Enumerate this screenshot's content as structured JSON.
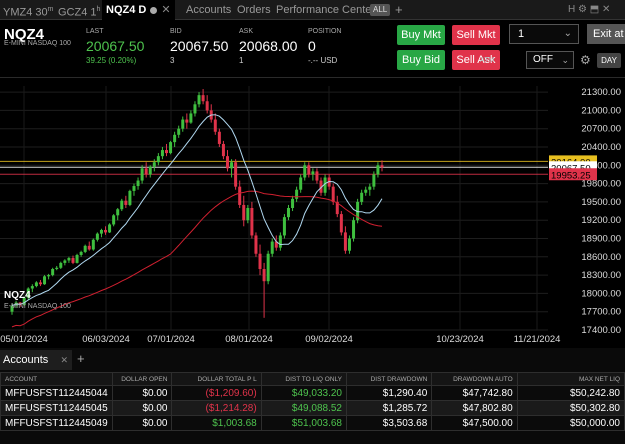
{
  "tabs": [
    {
      "label": "YMZ4 30",
      "suffix": "m"
    },
    {
      "label": "GCZ4 1",
      "suffix": "h"
    },
    {
      "label": "NQZ4 D"
    },
    {
      "label": "Accounts"
    },
    {
      "label": "Orders"
    },
    {
      "label": "Performance Center"
    }
  ],
  "tabs_badge": "ALL",
  "tabs_add": "+",
  "window_controls": "H ⚙ ⬒ ✕",
  "quote": {
    "symbol": "NQZ4",
    "description": "E-MINI NASDAQ 100",
    "last_label": "LAST",
    "last": "20067.50",
    "change": "39.25 (0.20%)",
    "bid_label": "BID",
    "bid": "20067.50",
    "bid_size": "3",
    "ask_label": "ASK",
    "ask": "20068.00",
    "ask_size": "1",
    "position_label": "POSITION",
    "position": "0",
    "position_value": "-.-- USD"
  },
  "order_buttons": {
    "buy_mkt": "Buy Mkt",
    "sell_mkt": "Sell Mkt",
    "buy_bid": "Buy Bid",
    "sell_ask": "Sell Ask",
    "quantity": "1",
    "exit": "Exit at",
    "atm_label": "ATM",
    "atm_value": "OFF",
    "day": "DAY"
  },
  "chart_data": {
    "type": "candlestick",
    "symbol": "NQZ4",
    "description": "E-MINI NASDAQ 100",
    "y_ticks": [
      "21300.00",
      "21000.00",
      "20700.00",
      "20400.00",
      "20100.00",
      "19800.00",
      "19500.00",
      "19200.00",
      "18900.00",
      "18600.00",
      "18300.00",
      "18000.00",
      "17700.00",
      "17400.00"
    ],
    "ylim": [
      17400,
      21400
    ],
    "x_ticks": [
      "05/01/2024",
      "06/03/2024",
      "07/01/2024",
      "08/01/2024",
      "09/02/2024",
      "10/23/2024",
      "11/21/2024"
    ],
    "price_labels": [
      {
        "text": "20164.00",
        "value": 20164,
        "color": "#e8c020"
      },
      {
        "text": "20067.50",
        "value": 20067.5,
        "color": "#ffffff"
      },
      {
        "text": "19953.25",
        "value": 19953.25,
        "color": "#e0334a"
      }
    ],
    "candles": [
      [
        17700,
        17830,
        17650,
        17800
      ],
      [
        17800,
        17880,
        17760,
        17850
      ],
      [
        17850,
        17860,
        17780,
        17810
      ],
      [
        17810,
        17950,
        17800,
        17930
      ],
      [
        17930,
        18100,
        17900,
        18080
      ],
      [
        18080,
        18150,
        18020,
        18120
      ],
      [
        18120,
        18200,
        18100,
        18180
      ],
      [
        18180,
        18220,
        18120,
        18150
      ],
      [
        18150,
        18300,
        18140,
        18280
      ],
      [
        18280,
        18320,
        18230,
        18300
      ],
      [
        18300,
        18420,
        18280,
        18400
      ],
      [
        18400,
        18450,
        18380,
        18420
      ],
      [
        18420,
        18520,
        18400,
        18500
      ],
      [
        18500,
        18560,
        18460,
        18540
      ],
      [
        18540,
        18600,
        18500,
        18580
      ],
      [
        18580,
        18620,
        18480,
        18500
      ],
      [
        18500,
        18650,
        18490,
        18630
      ],
      [
        18630,
        18700,
        18600,
        18680
      ],
      [
        18680,
        18800,
        18660,
        18780
      ],
      [
        18780,
        18850,
        18700,
        18720
      ],
      [
        18720,
        18900,
        18700,
        18880
      ],
      [
        18880,
        19000,
        18850,
        18980
      ],
      [
        18980,
        19060,
        18920,
        19040
      ],
      [
        19040,
        19100,
        18960,
        19000
      ],
      [
        19000,
        19150,
        18990,
        19130
      ],
      [
        19130,
        19300,
        19100,
        19280
      ],
      [
        19280,
        19400,
        19200,
        19380
      ],
      [
        19380,
        19550,
        19350,
        19520
      ],
      [
        19520,
        19600,
        19400,
        19450
      ],
      [
        19450,
        19700,
        19430,
        19680
      ],
      [
        19680,
        19800,
        19600,
        19760
      ],
      [
        19760,
        19900,
        19700,
        19850
      ],
      [
        19850,
        20100,
        19800,
        20050
      ],
      [
        20050,
        20150,
        19900,
        19950
      ],
      [
        19950,
        20100,
        19900,
        20080
      ],
      [
        20080,
        20200,
        20000,
        20150
      ],
      [
        20150,
        20300,
        20100,
        20250
      ],
      [
        20250,
        20400,
        20200,
        20350
      ],
      [
        20350,
        20450,
        20250,
        20300
      ],
      [
        20300,
        20500,
        20280,
        20480
      ],
      [
        20480,
        20650,
        20400,
        20600
      ],
      [
        20600,
        20750,
        20550,
        20700
      ],
      [
        20700,
        20900,
        20650,
        20850
      ],
      [
        20850,
        20950,
        20700,
        20800
      ],
      [
        20800,
        21000,
        20780,
        20950
      ],
      [
        20950,
        21150,
        20900,
        21100
      ],
      [
        21100,
        21300,
        21050,
        21250
      ],
      [
        21250,
        21350,
        21100,
        21150
      ],
      [
        21150,
        21250,
        20950,
        21000
      ],
      [
        21000,
        21100,
        20800,
        20850
      ],
      [
        20850,
        20950,
        20600,
        20650
      ],
      [
        20650,
        20700,
        20400,
        20450
      ],
      [
        20450,
        20500,
        20200,
        20250
      ],
      [
        20250,
        20350,
        20000,
        20050
      ],
      [
        20050,
        20200,
        19900,
        20150
      ],
      [
        20150,
        20200,
        19700,
        19750
      ],
      [
        19750,
        19850,
        19400,
        19450
      ],
      [
        19450,
        19600,
        19100,
        19200
      ],
      [
        19200,
        19450,
        19150,
        19400
      ],
      [
        19400,
        19500,
        18900,
        18950
      ],
      [
        18950,
        19000,
        18600,
        18650
      ],
      [
        18650,
        18800,
        18300,
        18400
      ],
      [
        18400,
        18500,
        17600,
        18200
      ],
      [
        18200,
        18700,
        18150,
        18650
      ],
      [
        18650,
        18900,
        18600,
        18850
      ],
      [
        18850,
        18950,
        18700,
        18750
      ],
      [
        18750,
        19000,
        18700,
        18950
      ],
      [
        18950,
        19300,
        18900,
        19250
      ],
      [
        19250,
        19450,
        19200,
        19400
      ],
      [
        19400,
        19600,
        19350,
        19550
      ],
      [
        19550,
        19750,
        19500,
        19700
      ],
      [
        19700,
        19950,
        19650,
        19900
      ],
      [
        19900,
        20150,
        19850,
        20100
      ],
      [
        20100,
        20150,
        19900,
        19950
      ],
      [
        19950,
        20050,
        19850,
        20000
      ],
      [
        20000,
        20050,
        19800,
        19850
      ],
      [
        19850,
        19900,
        19600,
        19650
      ],
      [
        19650,
        19950,
        19600,
        19900
      ],
      [
        19900,
        19950,
        19700,
        19750
      ],
      [
        19750,
        19800,
        19450,
        19500
      ],
      [
        19500,
        19600,
        19250,
        19300
      ],
      [
        19300,
        19350,
        18950,
        19000
      ],
      [
        19000,
        19100,
        18650,
        18700
      ],
      [
        18700,
        18950,
        18650,
        18900
      ],
      [
        18900,
        19250,
        18850,
        19200
      ],
      [
        19200,
        19550,
        19150,
        19500
      ],
      [
        19500,
        19700,
        19450,
        19650
      ],
      [
        19650,
        19750,
        19600,
        19700
      ],
      [
        19700,
        19800,
        19600,
        19750
      ],
      [
        19750,
        20000,
        19700,
        19950
      ],
      [
        19950,
        20150,
        19900,
        20100
      ],
      [
        20100,
        20180,
        20000,
        20067.5
      ]
    ],
    "ma_fast_color": "#b0d8f0",
    "ma_slow_color": "#d02030",
    "up_color": "#3fbf3f",
    "down_color": "#e0334a",
    "grid": true
  },
  "accounts": {
    "tab_label": "Accounts",
    "add": "+",
    "columns": [
      "ACCOUNT",
      "DOLLAR OPEN",
      "DOLLAR TOTAL P L",
      "DIST TO LIQ ONLY",
      "DIST DRAWDOWN",
      "DRAWDOWN AUTO",
      "MAX NET LIQ"
    ],
    "rows": [
      {
        "account": "MFFUSFST112445044",
        "open": "$0.00",
        "total_pl": "($1,209.60)",
        "dist_liq": "$49,033.20",
        "dist_dd": "$1,290.40",
        "dd_auto": "$47,742.80",
        "max_net": "$50,242.80"
      },
      {
        "account": "MFFUSFST112445045",
        "open": "$0.00",
        "total_pl": "($1,214.28)",
        "dist_liq": "$49,088.52",
        "dist_dd": "$1,285.72",
        "dd_auto": "$47,802.80",
        "max_net": "$50,302.80"
      },
      {
        "account": "MFFUSFST112445049",
        "open": "$0.00",
        "total_pl": "$1,003.68",
        "dist_liq": "$51,003.68",
        "dist_dd": "$3,503.68",
        "dd_auto": "$47,500.00",
        "max_net": "$50,000.00"
      }
    ]
  }
}
